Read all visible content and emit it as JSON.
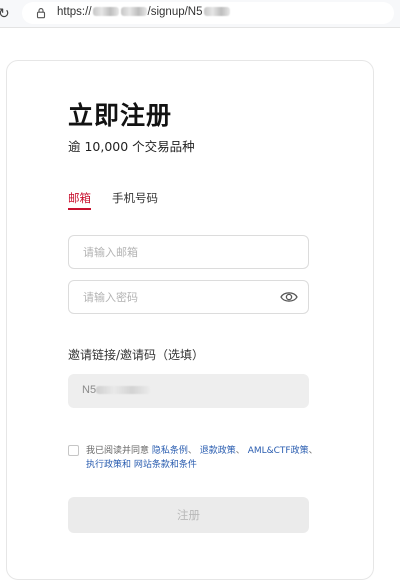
{
  "browser": {
    "url_prefix": "https://",
    "url_path": "/signup/N5"
  },
  "signup": {
    "title": "立即注册",
    "subtitle": "逾 10,000 个交易品种",
    "tabs": [
      "邮箱",
      "手机号码"
    ],
    "email_placeholder": "请输入邮箱",
    "password_placeholder": "请输入密码",
    "invite_label": "邀请链接/邀请码（选填）",
    "invite_prefix": "N5",
    "consent": {
      "lead": "我已阅读并同意 ",
      "links": [
        "隐私条例",
        "退款政策",
        "AML&CTF政策",
        "执行政策和",
        "网站条款和条件"
      ],
      "sep": "、",
      "space": " "
    },
    "submit_label": "注册"
  },
  "colors": {
    "accent": "#c8102e",
    "link": "#2a5db0"
  },
  "icons": [
    "reload-icon",
    "lock-icon",
    "eye-icon"
  ]
}
